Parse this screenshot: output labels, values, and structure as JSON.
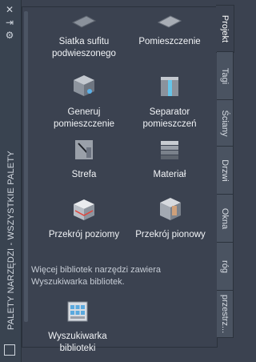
{
  "palette": {
    "title": "PALETY NARZĘDZI - WSZYSTKIE PALETY",
    "controls": {
      "close": "✕",
      "autohide": "⇥",
      "settings": "⚙"
    }
  },
  "tools": [
    {
      "label": "Siatka sufitu\npodwieszonego",
      "icon": "ceiling-grid-icon"
    },
    {
      "label": "Pomieszczenie",
      "icon": "space-icon"
    },
    {
      "label": "Generuj\npomieszczenie",
      "icon": "generate-space-icon"
    },
    {
      "label": "Separator\npomieszczeń",
      "icon": "space-separator-icon"
    },
    {
      "label": "Strefa",
      "icon": "zone-icon"
    },
    {
      "label": "Materiał",
      "icon": "material-icon"
    },
    {
      "label": "Przekrój poziomy",
      "icon": "horizontal-section-icon"
    },
    {
      "label": "Przekrój pionowy",
      "icon": "vertical-section-icon"
    },
    {
      "label": "Wyszukiwarka\nbiblioteki",
      "icon": "library-search-icon"
    }
  ],
  "info_text": "Więcej bibliotek narzędzi zawiera Wyszukiwarka bibliotek.",
  "tabs": [
    "Projekt",
    "Tagi",
    "Ściany",
    "Drzwi",
    "Okna",
    "róg",
    "przestrz..."
  ],
  "active_tab": "Projekt"
}
